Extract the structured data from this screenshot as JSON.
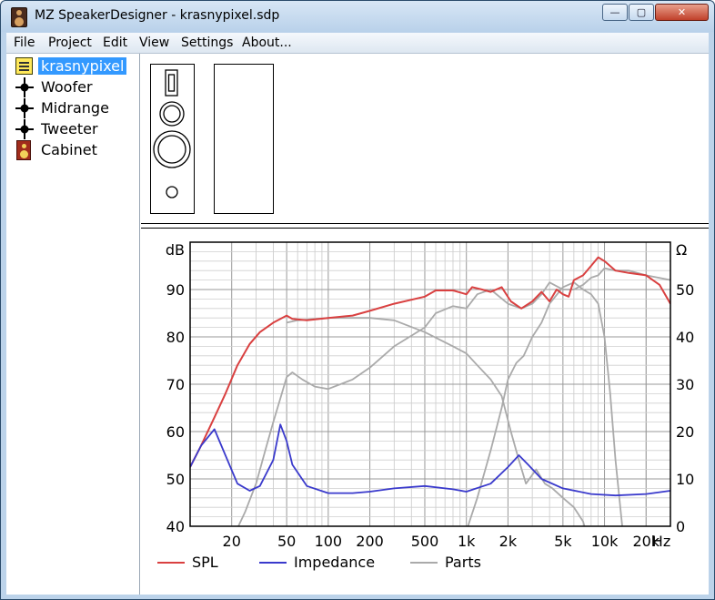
{
  "window": {
    "title": "MZ SpeakerDesigner - krasnypixel.sdp",
    "min_symbol": "—",
    "max_symbol": "▢",
    "close_symbol": "✕"
  },
  "menu": {
    "items": [
      "File",
      "Project",
      "Edit",
      "View",
      "Settings",
      "About..."
    ]
  },
  "tree": {
    "items": [
      {
        "label": "krasnypixel",
        "icon": "project-icon"
      },
      {
        "label": "Woofer",
        "icon": "driver-node-icon"
      },
      {
        "label": "Midrange",
        "icon": "driver-node-icon"
      },
      {
        "label": "Tweeter",
        "icon": "driver-node-icon"
      },
      {
        "label": "Cabinet",
        "icon": "cabinet-icon"
      }
    ]
  },
  "chart_data": {
    "type": "line",
    "x_scale": "log",
    "xlim": [
      10,
      30000
    ],
    "ylim": [
      40,
      100
    ],
    "y2lim": [
      0,
      60
    ],
    "ylabel": "dB",
    "y2label": "Ω",
    "xunit": "Hz",
    "y_ticks": [
      40,
      50,
      60,
      70,
      80,
      90
    ],
    "y2_ticks": [
      0,
      10,
      20,
      30,
      40,
      50
    ],
    "x_tick_labels": [
      {
        "value": 20,
        "label": "20"
      },
      {
        "value": 50,
        "label": "50"
      },
      {
        "value": 100,
        "label": "100"
      },
      {
        "value": 200,
        "label": "200"
      },
      {
        "value": 500,
        "label": "500"
      },
      {
        "value": 1000,
        "label": "1k"
      },
      {
        "value": 2000,
        "label": "2k"
      },
      {
        "value": 5000,
        "label": "5k"
      },
      {
        "value": 10000,
        "label": "10k"
      },
      {
        "value": 20000,
        "label": "20k"
      }
    ],
    "grid": true,
    "series": [
      {
        "name": "SPL",
        "color": "#d94040",
        "axis": "left",
        "points": [
          [
            10,
            52.5
          ],
          [
            12,
            57
          ],
          [
            15,
            63
          ],
          [
            18,
            68
          ],
          [
            22,
            74
          ],
          [
            27,
            78.5
          ],
          [
            32,
            81
          ],
          [
            40,
            83
          ],
          [
            50,
            84.5
          ],
          [
            55,
            83.8
          ],
          [
            70,
            83.5
          ],
          [
            100,
            84
          ],
          [
            150,
            84.5
          ],
          [
            200,
            85.5
          ],
          [
            300,
            87
          ],
          [
            500,
            88.5
          ],
          [
            600,
            89.8
          ],
          [
            800,
            89.8
          ],
          [
            1000,
            89
          ],
          [
            1100,
            90.5
          ],
          [
            1300,
            90
          ],
          [
            1500,
            89.5
          ],
          [
            1800,
            90.5
          ],
          [
            2100,
            87.5
          ],
          [
            2500,
            86
          ],
          [
            3000,
            87.5
          ],
          [
            3500,
            89.5
          ],
          [
            4000,
            87.5
          ],
          [
            4500,
            90
          ],
          [
            5000,
            89
          ],
          [
            5500,
            88.5
          ],
          [
            6000,
            92
          ],
          [
            7000,
            93
          ],
          [
            8000,
            95
          ],
          [
            9000,
            96.8
          ],
          [
            10000,
            96
          ],
          [
            12000,
            94
          ],
          [
            15000,
            93.5
          ],
          [
            20000,
            93
          ],
          [
            25000,
            91
          ],
          [
            30000,
            87
          ]
        ]
      },
      {
        "name": "Impedance",
        "color": "#3a3acc",
        "axis": "right",
        "points": [
          [
            10,
            12.5
          ],
          [
            12,
            17
          ],
          [
            15,
            20.5
          ],
          [
            18,
            15
          ],
          [
            22,
            9
          ],
          [
            27,
            7.5
          ],
          [
            32,
            8.5
          ],
          [
            40,
            14
          ],
          [
            45,
            21.5
          ],
          [
            50,
            18
          ],
          [
            55,
            13
          ],
          [
            70,
            8.5
          ],
          [
            100,
            7
          ],
          [
            150,
            7
          ],
          [
            200,
            7.3
          ],
          [
            300,
            8
          ],
          [
            500,
            8.5
          ],
          [
            800,
            7.8
          ],
          [
            1000,
            7.3
          ],
          [
            1500,
            9
          ],
          [
            2000,
            12.5
          ],
          [
            2400,
            15
          ],
          [
            2800,
            13
          ],
          [
            3500,
            10
          ],
          [
            5000,
            8
          ],
          [
            8000,
            6.8
          ],
          [
            12000,
            6.5
          ],
          [
            20000,
            6.8
          ],
          [
            30000,
            7.5
          ]
        ]
      },
      {
        "name": "Parts",
        "color": "#aaaaaa",
        "axis": "right",
        "points": [
          [
            10,
            -20
          ],
          [
            15,
            -10
          ],
          [
            20,
            -3
          ],
          [
            25,
            3
          ],
          [
            30,
            9
          ],
          [
            35,
            16
          ],
          [
            40,
            22
          ],
          [
            45,
            27
          ],
          [
            50,
            31.5
          ],
          [
            55,
            32.5
          ],
          [
            65,
            31
          ],
          [
            80,
            29.5
          ],
          [
            100,
            29
          ],
          [
            150,
            31
          ],
          [
            200,
            33.5
          ],
          [
            300,
            38
          ],
          [
            500,
            42
          ],
          [
            600,
            45
          ],
          [
            800,
            46.5
          ],
          [
            1000,
            46
          ],
          [
            1200,
            49
          ],
          [
            1500,
            50
          ],
          [
            2000,
            47
          ],
          [
            2500,
            46
          ],
          [
            3000,
            47
          ],
          [
            3500,
            49
          ],
          [
            4000,
            51.5
          ],
          [
            5000,
            50
          ],
          [
            6000,
            50
          ],
          [
            7000,
            51
          ],
          [
            8000,
            52.5
          ],
          [
            9000,
            53
          ],
          [
            10000,
            54.5
          ],
          [
            12000,
            54
          ],
          [
            15000,
            54
          ],
          [
            20000,
            53
          ],
          [
            30000,
            52
          ]
        ]
      },
      {
        "name": "Parts",
        "color": "#aaaaaa",
        "axis": "right",
        "points": [
          [
            50,
            43
          ],
          [
            60,
            43.5
          ],
          [
            100,
            44
          ],
          [
            200,
            44
          ],
          [
            300,
            43.5
          ],
          [
            500,
            41
          ],
          [
            800,
            38
          ],
          [
            1000,
            36.5
          ],
          [
            1200,
            34
          ],
          [
            1500,
            31
          ],
          [
            1800,
            27.5
          ],
          [
            2100,
            20
          ],
          [
            2400,
            14
          ],
          [
            2700,
            9
          ],
          [
            3200,
            12
          ],
          [
            3700,
            9
          ],
          [
            4200,
            8
          ],
          [
            5000,
            6
          ],
          [
            6000,
            4
          ],
          [
            7000,
            1
          ],
          [
            8000,
            -5
          ]
        ]
      },
      {
        "name": "Parts",
        "color": "#aaaaaa",
        "axis": "right",
        "points": [
          [
            900,
            -5
          ],
          [
            1000,
            -1
          ],
          [
            1200,
            6
          ],
          [
            1500,
            16
          ],
          [
            1800,
            25
          ],
          [
            2000,
            31
          ],
          [
            2300,
            34.5
          ],
          [
            2600,
            36
          ],
          [
            3000,
            40
          ],
          [
            3500,
            43
          ],
          [
            4000,
            47
          ],
          [
            5000,
            50.5
          ],
          [
            6000,
            51.5
          ],
          [
            7000,
            50
          ],
          [
            8000,
            49
          ],
          [
            9000,
            47
          ],
          [
            10000,
            40
          ],
          [
            11000,
            28
          ],
          [
            12000,
            14
          ],
          [
            13000,
            4
          ],
          [
            14000,
            -5
          ]
        ]
      }
    ]
  },
  "legend": {
    "entries": [
      {
        "name": "SPL",
        "color": "#d94040"
      },
      {
        "name": "Impedance",
        "color": "#3a3acc"
      },
      {
        "name": "Parts",
        "color": "#aaaaaa"
      }
    ]
  }
}
